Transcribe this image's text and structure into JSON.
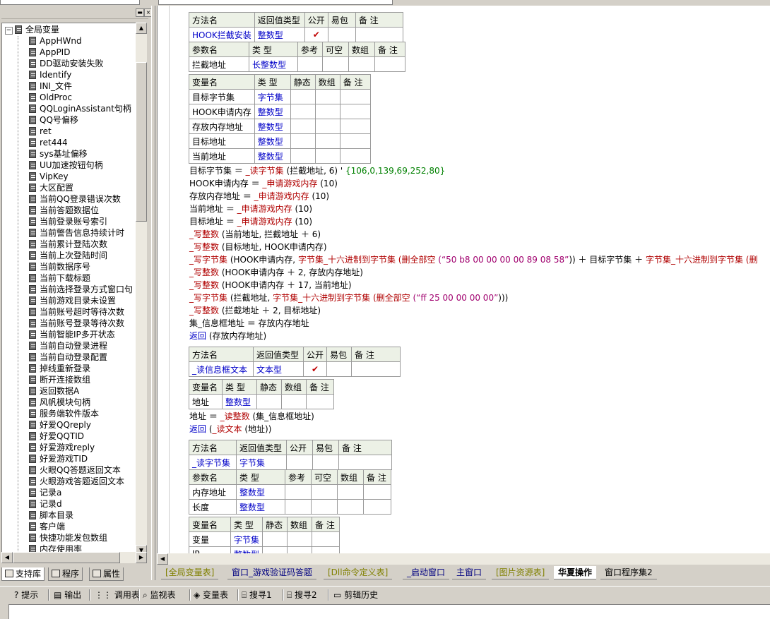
{
  "left_panel": {
    "root_label": "全局变量",
    "items": [
      "AppHWnd",
      "AppPID",
      "DD驱动安装失败",
      "Identify",
      "INI_文件",
      "OldProc",
      "QQLoginAssistant句柄",
      "QQ号偏移",
      "ret",
      "ret444",
      "sys基址偏移",
      "UU加速按钮句柄",
      "VipKey",
      "大区配置",
      "当前QQ登录错误次数",
      "当前答题数据位",
      "当前登录账号索引",
      "当前警告信息持续计时",
      "当前累计登陆次数",
      "当前上次登陆时间",
      "当前数据序号",
      "当前下载标题",
      "当前选择登录方式窗口句",
      "当前游戏目录未设置",
      "当前账号超时等待次数",
      "当前账号登录等待次数",
      "当前智能IP多开状态",
      "当前自动登录进程",
      "当前自动登录配置",
      "掉线重新登录",
      "断开连接数组",
      "返回数据A",
      "风帆模块句柄",
      "服务端软件版本",
      "好爱QQreply",
      "好爱QQTID",
      "好爱游戏reply",
      "好爱游戏TID",
      "火眼QQ答题返回文本",
      "火眼游戏答题返回文本",
      "记录a",
      "记录d",
      "脚本目录",
      "客户端",
      "快捷功能发包数组",
      "内存使用率"
    ],
    "tabs": [
      "支持库",
      "程序",
      "属性"
    ]
  },
  "editor": {
    "method1": {
      "hdr": [
        "方法名",
        "返回值类型",
        "公开",
        "易包",
        "备 注"
      ],
      "row": [
        "HOOK拦截安装",
        "整数型",
        "✔",
        "",
        ""
      ],
      "phdr": [
        "参数名",
        "类 型",
        "参考",
        "可空",
        "数组",
        "备 注"
      ],
      "params": [
        [
          "拦截地址",
          "长整数型",
          "",
          "",
          "",
          ""
        ]
      ]
    },
    "vars1": {
      "hdr": [
        "变量名",
        "类 型",
        "静态",
        "数组",
        "备 注"
      ],
      "rows": [
        [
          "目标字节集",
          "字节集"
        ],
        [
          "HOOK申请内存",
          "整数型"
        ],
        [
          "存放内存地址",
          "整数型"
        ],
        [
          "目标地址",
          "整数型"
        ],
        [
          "当前地址",
          "整数型"
        ]
      ]
    },
    "code1": [
      {
        "t": "目标字节集 ＝ "
      },
      {
        "t": "HOOK申请内存 ＝ "
      },
      {
        "t": "存放内存地址 ＝ "
      },
      {
        "t": "当前地址 ＝ "
      },
      {
        "t": "目标地址 ＝ "
      }
    ],
    "c": {
      "l1_fn": "_读字节集",
      "l1_args": " (拦截地址, 6)  ' ",
      "l1_cm": "{106,0,139,69,252,80}",
      "alloc_fn": "_申请游戏内存",
      "alloc_arg": " (10)",
      "w_int": "_写整数",
      "w_bytes": "_写字节集",
      "l6_args": " (当前地址, 拦截地址 ＋ 6)",
      "l7_args": " (目标地址, HOOK申请内存)",
      "l8_a": " (HOOK申请内存, ",
      "hex2bytes": "字节集_十六进制到字节集",
      "del_all": " (删全部空",
      "l8_str": " (“50 b8 00 00 00 00 89 08 58”",
      "l8_b": ")) ＋ 目标字节集 ＋ ",
      "l8_c": " (删",
      "l9_args": " (HOOK申请内存 ＋ 2, 存放内存地址)",
      "l10_args": " (HOOK申请内存 ＋ 17, 当前地址)",
      "l11_a": " (拦截地址, ",
      "l11_str": " (“ff 25 00 00 00 00”",
      "l11_b": ")))",
      "l12_args": " (拦截地址 ＋ 2, 目标地址)",
      "l13": "集_信息框地址 ＝ 存放内存地址",
      "ret": "返回",
      "l14_args": " (存放内存地址)",
      "read_int": "_读整数",
      "read_text": "_读文本",
      "l15_pre": "地址 ＝ ",
      "l15_args": " (集_信息框地址)",
      "l16_args": " (地址))"
    },
    "method2": {
      "hdr": [
        "方法名",
        "返回值类型",
        "公开",
        "易包",
        "备 注"
      ],
      "row": [
        "_读信息框文本",
        "文本型",
        "✔",
        "",
        ""
      ]
    },
    "vars2": {
      "hdr": [
        "变量名",
        "类 型",
        "静态",
        "数组",
        "备 注"
      ],
      "rows": [
        [
          "地址",
          "整数型"
        ]
      ]
    },
    "method3": {
      "hdr": [
        "方法名",
        "返回值类型",
        "公开",
        "易包",
        "备 注"
      ],
      "row": [
        "_读字节集",
        "字节集",
        "",
        "",
        ""
      ],
      "phdr": [
        "参数名",
        "类 型",
        "参考",
        "可空",
        "数组",
        "备 注"
      ],
      "params": [
        [
          "内存地址",
          "整数型"
        ],
        [
          "长度",
          "整数型"
        ]
      ]
    },
    "vars3": {
      "hdr": [
        "变量名",
        "类 型",
        "静态",
        "数组",
        "备 注"
      ],
      "rows": [
        [
          "变量",
          "字节集"
        ],
        [
          "lP",
          "整数型"
        ]
      ]
    }
  },
  "bottom_tabs": [
    "[全局变量表]",
    "窗口_游戏验证码答题",
    "[Dll命令定义表]",
    "_启动窗口",
    "主窗口",
    "[图片资源表]",
    "华夏操作",
    "窗口程序集2"
  ],
  "active_tab": "华夏操作",
  "toolbar": [
    "提示",
    "输出",
    "调用表",
    "监视表",
    "变量表",
    "搜寻1",
    "搜寻2",
    "剪辑历史"
  ],
  "colors": {
    "header_bg": "#ecf1e6",
    "type_blue": "#0000c8",
    "fn_red": "#b00000",
    "str_magenta": "#a0006e",
    "comment_green": "#008000"
  }
}
